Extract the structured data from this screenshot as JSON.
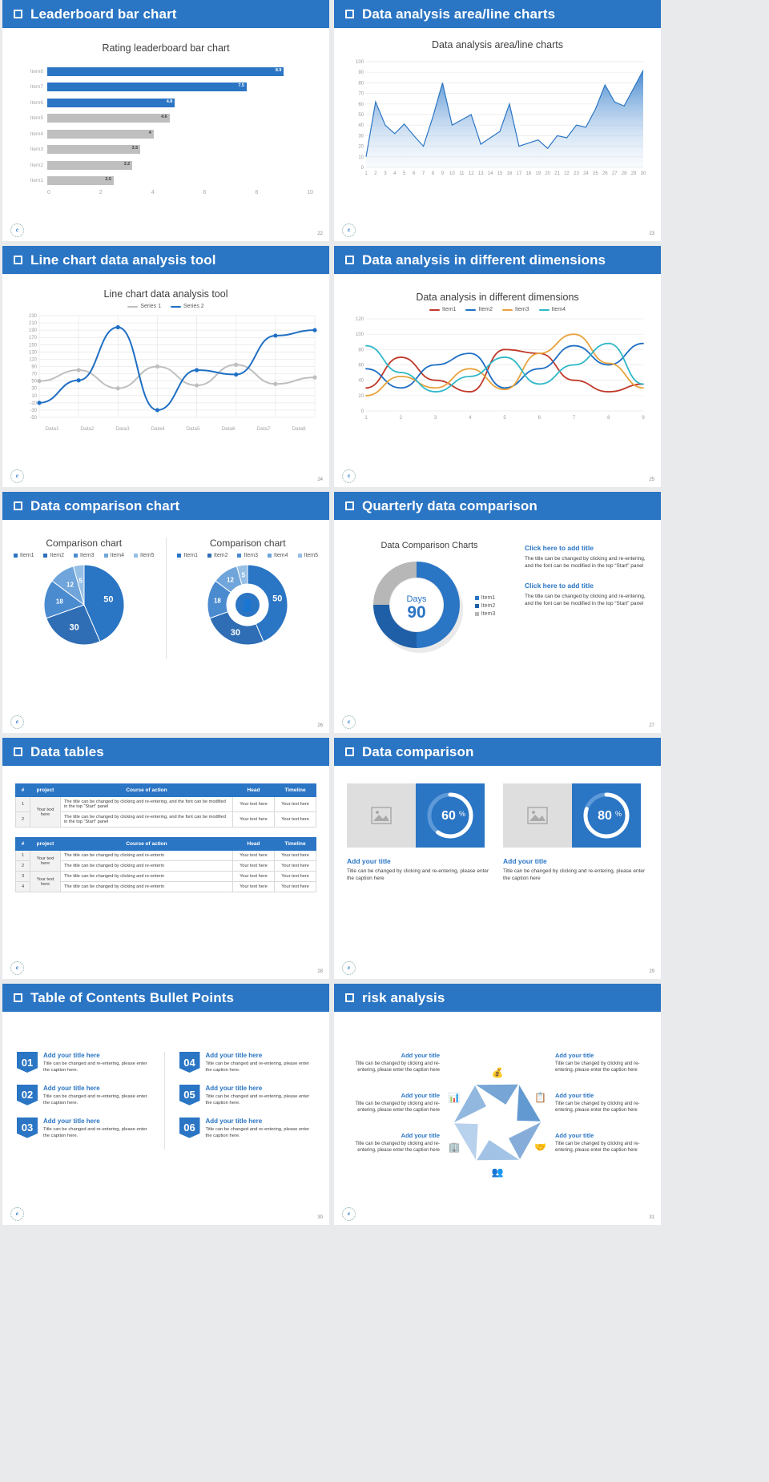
{
  "slides": [
    {
      "n": 1,
      "title": "Leaderboard bar chart",
      "page": "22",
      "chart_title": "Rating leaderboard bar chart"
    },
    {
      "n": 2,
      "title": "Data analysis area/line charts",
      "page": "23",
      "chart_title": "Data analysis area/line charts"
    },
    {
      "n": 3,
      "title": "Line chart data analysis tool",
      "page": "24",
      "chart_title": "Line chart data analysis tool"
    },
    {
      "n": 4,
      "title": "Data analysis in different dimensions",
      "page": "25",
      "chart_title": "Data analysis in different dimensions"
    },
    {
      "n": 5,
      "title": "Data comparison chart",
      "page": "26",
      "chart_title": "Comparison chart"
    },
    {
      "n": 6,
      "title": "Quarterly data comparison",
      "page": "27",
      "chart_title": "Data Comparison Charts"
    },
    {
      "n": 7,
      "title": "Data tables",
      "page": "28",
      "chart_title": ""
    },
    {
      "n": 8,
      "title": "Data comparison",
      "page": "29",
      "chart_title": ""
    },
    {
      "n": 9,
      "title": "Table of Contents Bullet Points",
      "page": "30",
      "chart_title": ""
    },
    {
      "n": 10,
      "title": "risk analysis",
      "page": "31",
      "chart_title": ""
    }
  ],
  "logo_text": "logo",
  "chart_data": [
    {
      "type": "bar",
      "title": "Rating leaderboard bar chart",
      "orientation": "horizontal",
      "categories": [
        "Item8",
        "Item7",
        "Item6",
        "Item5",
        "Item4",
        "Item3",
        "Item2",
        "Item1"
      ],
      "values": [
        8.9,
        7.5,
        4.8,
        4.6,
        4,
        3.5,
        3.2,
        2.5
      ],
      "value_labels": [
        "8.9",
        "7.5",
        "4.8",
        "4.6",
        "4",
        "3.5",
        "3.2",
        "2.5"
      ],
      "colors": [
        "#2a75c4",
        "#2a75c4",
        "#2a75c4",
        "#bfbfbf",
        "#bfbfbf",
        "#bfbfbf",
        "#bfbfbf",
        "#bfbfbf"
      ],
      "xticks": [
        "0",
        "2",
        "4",
        "6",
        "8",
        "10"
      ],
      "xlim": [
        0,
        10
      ],
      "xlabel": "",
      "ylabel": "",
      "grid": true,
      "legend": "none"
    },
    {
      "type": "area",
      "title": "Data analysis area/line charts",
      "x": [
        "1",
        "2",
        "3",
        "4",
        "5",
        "6",
        "7",
        "8",
        "9",
        "10",
        "11",
        "12",
        "13",
        "14",
        "15",
        "16",
        "17",
        "18",
        "19",
        "20",
        "21",
        "22",
        "23",
        "24",
        "25",
        "26",
        "27",
        "28",
        "29",
        "30"
      ],
      "values": [
        10,
        62,
        40,
        32,
        41,
        30,
        20,
        48,
        80,
        40,
        45,
        50,
        22,
        28,
        34,
        60,
        20,
        23,
        26,
        18,
        30,
        28,
        40,
        38,
        55,
        78,
        62,
        58,
        75,
        92
      ],
      "yticks": [
        "0",
        "10",
        "20",
        "30",
        "40",
        "50",
        "60",
        "70",
        "80",
        "90",
        "100"
      ],
      "ylim": [
        0,
        100
      ],
      "xlabel": "",
      "ylabel": "",
      "grid": true,
      "legend": "none",
      "series_color": "#2a75c4"
    },
    {
      "type": "line",
      "title": "Line chart data analysis tool",
      "categories": [
        "Data1",
        "Data2",
        "Data3",
        "Data4",
        "Data5",
        "Data6",
        "Data7",
        "Data8"
      ],
      "series": [
        {
          "name": "Series 1",
          "color": "#bfbfbf",
          "values": [
            50,
            80,
            30,
            90,
            38,
            95,
            42,
            60
          ]
        },
        {
          "name": "Series 2",
          "color": "#1f6fc4",
          "values": [
            -10,
            52,
            198,
            -30,
            80,
            68,
            175,
            190
          ]
        }
      ],
      "yticks": [
        "-50",
        "-30",
        "-10",
        "10",
        "30",
        "50",
        "70",
        "90",
        "110",
        "130",
        "150",
        "170",
        "190",
        "210",
        "230"
      ],
      "ylim": [
        -50,
        230
      ],
      "xlabel": "",
      "ylabel": "",
      "grid": true,
      "legend": "top"
    },
    {
      "type": "line",
      "title": "Data analysis in different dimensions",
      "x": [
        "1",
        "2",
        "3",
        "4",
        "5",
        "6",
        "7",
        "8",
        "9"
      ],
      "series": [
        {
          "name": "Item1",
          "color": "#c0392b",
          "values": [
            30,
            70,
            40,
            25,
            80,
            75,
            40,
            25,
            35
          ]
        },
        {
          "name": "Item2",
          "color": "#1f6fc4",
          "values": [
            55,
            30,
            60,
            75,
            30,
            55,
            85,
            60,
            88
          ]
        },
        {
          "name": "Item3",
          "color": "#e8a33d",
          "values": [
            20,
            45,
            30,
            55,
            28,
            75,
            100,
            62,
            30
          ]
        },
        {
          "name": "Item4",
          "color": "#2eb8c8",
          "values": [
            85,
            50,
            25,
            45,
            70,
            35,
            60,
            88,
            35
          ]
        }
      ],
      "yticks": [
        "0",
        "20",
        "40",
        "60",
        "80",
        "100",
        "120"
      ],
      "ylim": [
        0,
        120
      ],
      "xlabel": "",
      "ylabel": "",
      "grid": true,
      "legend": "top"
    },
    {
      "type": "pie",
      "title": "Comparison chart",
      "legend_items": [
        "Item1",
        "Item2",
        "Item3",
        "Item4",
        "Item5"
      ],
      "labels": [
        "50",
        "30",
        "18",
        "12",
        "5"
      ],
      "values": [
        50,
        30,
        18,
        12,
        5
      ],
      "legend": "top"
    },
    {
      "type": "pie",
      "title": "Comparison chart",
      "variant": "donut",
      "legend_items": [
        "Item1",
        "Item2",
        "Item3",
        "Item4",
        "Item5"
      ],
      "labels": [
        "50",
        "30",
        "18",
        "12",
        "5"
      ],
      "values": [
        50,
        30,
        18,
        12,
        5
      ],
      "legend": "top"
    },
    {
      "type": "pie",
      "variant": "donut",
      "title": "Data Comparison Charts",
      "center_label": "Days",
      "center_value": "90",
      "legend_items": [
        "Item1",
        "Item2",
        "Item3"
      ],
      "values": [
        50,
        25,
        25
      ],
      "legend": "right"
    },
    {
      "type": "pie",
      "variant": "gauge",
      "title": "",
      "values": [
        60
      ],
      "labels": [
        "60%"
      ],
      "legend": "none"
    },
    {
      "type": "pie",
      "variant": "gauge",
      "title": "",
      "values": [
        80
      ],
      "labels": [
        "80%"
      ],
      "legend": "none"
    }
  ],
  "slide5": {
    "chart_a_title": "Comparison chart",
    "chart_b_title": "Comparison chart",
    "legend": [
      "Item1",
      "Item2",
      "Item3",
      "Item4",
      "Item5"
    ],
    "slices": [
      "50",
      "30",
      "18",
      "12",
      "5"
    ]
  },
  "slide6": {
    "chart_title": "Data Comparison Charts",
    "center_label": "Days",
    "center_value": "90",
    "legend": [
      "Item1",
      "Item2",
      "Item3"
    ],
    "blocks": [
      {
        "heading": "Click here to add title",
        "body": "The title can be changed by clicking and re-entering, and the font can be modified in the top “Start” panel"
      },
      {
        "heading": "Click here to add title",
        "body": "The title can be changed by clicking and re-entering, and the font can be modified in the top “Start” panel"
      }
    ]
  },
  "slide7": {
    "table1": {
      "headers": [
        "#",
        "project",
        "Course of action",
        "Head",
        "Timeline"
      ],
      "rows": [
        {
          "num": "1",
          "project": "Your text here",
          "course": "The title can be changed by clicking and re-entering, and the font can be modified in the top “Start” panel",
          "head": "Your text here",
          "timeline": "Your text here"
        },
        {
          "num": "2",
          "project": "",
          "course": "The title can be changed by clicking and re-entering, and the font can be modified in the top “Start” panel",
          "head": "Your text here",
          "timeline": "Your text here"
        }
      ]
    },
    "table2": {
      "headers": [
        "#",
        "project",
        "Course of action",
        "Head",
        "Timeline"
      ],
      "rows": [
        {
          "num": "1",
          "project": "Your text here",
          "course": "The title can be changed by clicking and re-enterin",
          "head": "Your text here",
          "timeline": "Your text here"
        },
        {
          "num": "2",
          "project": "",
          "course": "The title can be changed by clicking and re-enterin",
          "head": "Your text here",
          "timeline": "Your text here"
        },
        {
          "num": "3",
          "project": "Your text here",
          "course": "The title can be changed by clicking and re-enterin",
          "head": "Your text here",
          "timeline": "Your text here"
        },
        {
          "num": "4",
          "project": "",
          "course": "The title can be changed by clicking and re-enterin",
          "head": "Your text here",
          "timeline": "Your text here"
        }
      ]
    }
  },
  "slide8": {
    "cards": [
      {
        "percent": "60",
        "suffix": "%",
        "heading": "Add your title",
        "body": "Title can be changed by clicking and re-entering, please enter the caption here"
      },
      {
        "percent": "80",
        "suffix": "%",
        "heading": "Add your title",
        "body": "Title can be changed by clicking and re-entering, please enter the caption here"
      }
    ]
  },
  "slide9": {
    "items": [
      {
        "num": "01",
        "heading": "Add your title here",
        "body": "Title can be changed and re-entering, please enter the caption here."
      },
      {
        "num": "02",
        "heading": "Add your title here",
        "body": "Title can be changed and re-entering, please enter the caption here."
      },
      {
        "num": "03",
        "heading": "Add your title here",
        "body": "Title can be changed and re-entering, please enter the caption here."
      },
      {
        "num": "04",
        "heading": "Add your title here",
        "body": "Title can be changed and re-entering, please enter the caption here."
      },
      {
        "num": "05",
        "heading": "Add your title here",
        "body": "Title can be changed and re-entering, please enter the caption here."
      },
      {
        "num": "06",
        "heading": "Add your title here",
        "body": "Title can be changed and re-entering, please enter the caption here."
      }
    ]
  },
  "slide10": {
    "items": [
      {
        "heading": "Add your title",
        "body": "Title can be changed by clicking and re-entering, please enter the caption here",
        "icon": "bag-icon"
      },
      {
        "heading": "Add your title",
        "body": "Title can be changed by clicking and re-entering, please enter the caption here",
        "icon": "document-icon"
      },
      {
        "heading": "Add your title",
        "body": "Title can be changed by clicking and re-entering, please enter the caption here",
        "icon": "handshake-icon"
      },
      {
        "heading": "Add your title",
        "body": "Title can be changed by clicking and re-entering, please enter the caption here",
        "icon": "people-icon"
      },
      {
        "heading": "Add your title",
        "body": "Title can be changed by clicking and re-entering, please enter the caption here",
        "icon": "building-icon"
      },
      {
        "heading": "Add your title",
        "body": "Title can be changed by clicking and re-entering, please enter the caption here",
        "icon": "piechart-icon"
      }
    ]
  },
  "colors": {
    "brand": "#2a75c4",
    "gray": "#bfbfbf",
    "light_gray": "#dedede"
  }
}
